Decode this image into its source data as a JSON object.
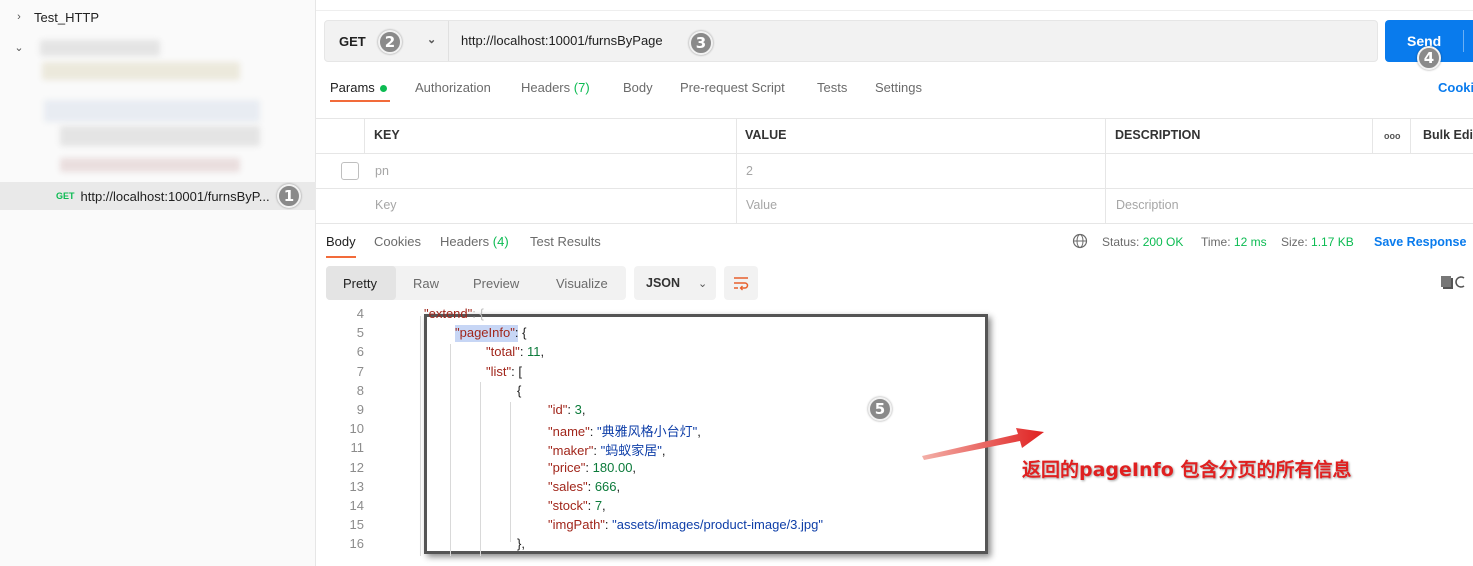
{
  "sidebar": {
    "collection_name": "Test_HTTP",
    "request": {
      "method": "GET",
      "label": "http://localhost:10001/furnsByP..."
    }
  },
  "request": {
    "method": "GET",
    "url": "http://localhost:10001/furnsByPage",
    "send_label": "Send",
    "tabs": [
      {
        "label": "Params",
        "active": true
      },
      {
        "label": "Authorization"
      },
      {
        "label": "Headers",
        "count": "(7)"
      },
      {
        "label": "Body"
      },
      {
        "label": "Pre-request Script"
      },
      {
        "label": "Tests"
      },
      {
        "label": "Settings"
      }
    ],
    "cookies_link": "Cooki"
  },
  "params_table": {
    "headers": [
      "KEY",
      "VALUE",
      "DESCRIPTION"
    ],
    "more_icon": "ooo",
    "bulk_edit": "Bulk Edi",
    "rows": [
      {
        "key": "pn",
        "value": "2",
        "description": ""
      }
    ],
    "placeholder": {
      "key": "Key",
      "value": "Value",
      "description": "Description"
    }
  },
  "response": {
    "tabs": [
      {
        "label": "Body",
        "active": true
      },
      {
        "label": "Cookies"
      },
      {
        "label": "Headers",
        "count": "(4)"
      },
      {
        "label": "Test Results"
      }
    ],
    "status_label": "Status:",
    "status_value": "200 OK",
    "time_label": "Time:",
    "time_value": "12 ms",
    "size_label": "Size:",
    "size_value": "1.17 KB",
    "save_response": "Save Response",
    "formats": [
      "Pretty",
      "Raw",
      "Preview",
      "Visualize"
    ],
    "language": "JSON"
  },
  "code": {
    "line_numbers": [
      "4",
      "5",
      "6",
      "7",
      "8",
      "9",
      "10",
      "11",
      "12",
      "13",
      "14",
      "15",
      "16"
    ],
    "lines": [
      "\"extend\": {",
      "\"pageInfo\": {",
      "\"total\": 11,",
      "\"list\": [",
      "{",
      "\"id\": 3,",
      "\"name\": \"典雅风格小台灯\",",
      "\"maker\": \"蚂蚁家居\",",
      "\"price\": 180.00,",
      "\"sales\": 666,",
      "\"stock\": 7,",
      "\"imgPath\": \"assets/images/product-image/3.jpg\"",
      "},"
    ]
  },
  "annotations": {
    "badges": [
      "1",
      "2",
      "3",
      "4",
      "5"
    ],
    "note": "返回的pageInfo 包含分页的所有信息"
  }
}
